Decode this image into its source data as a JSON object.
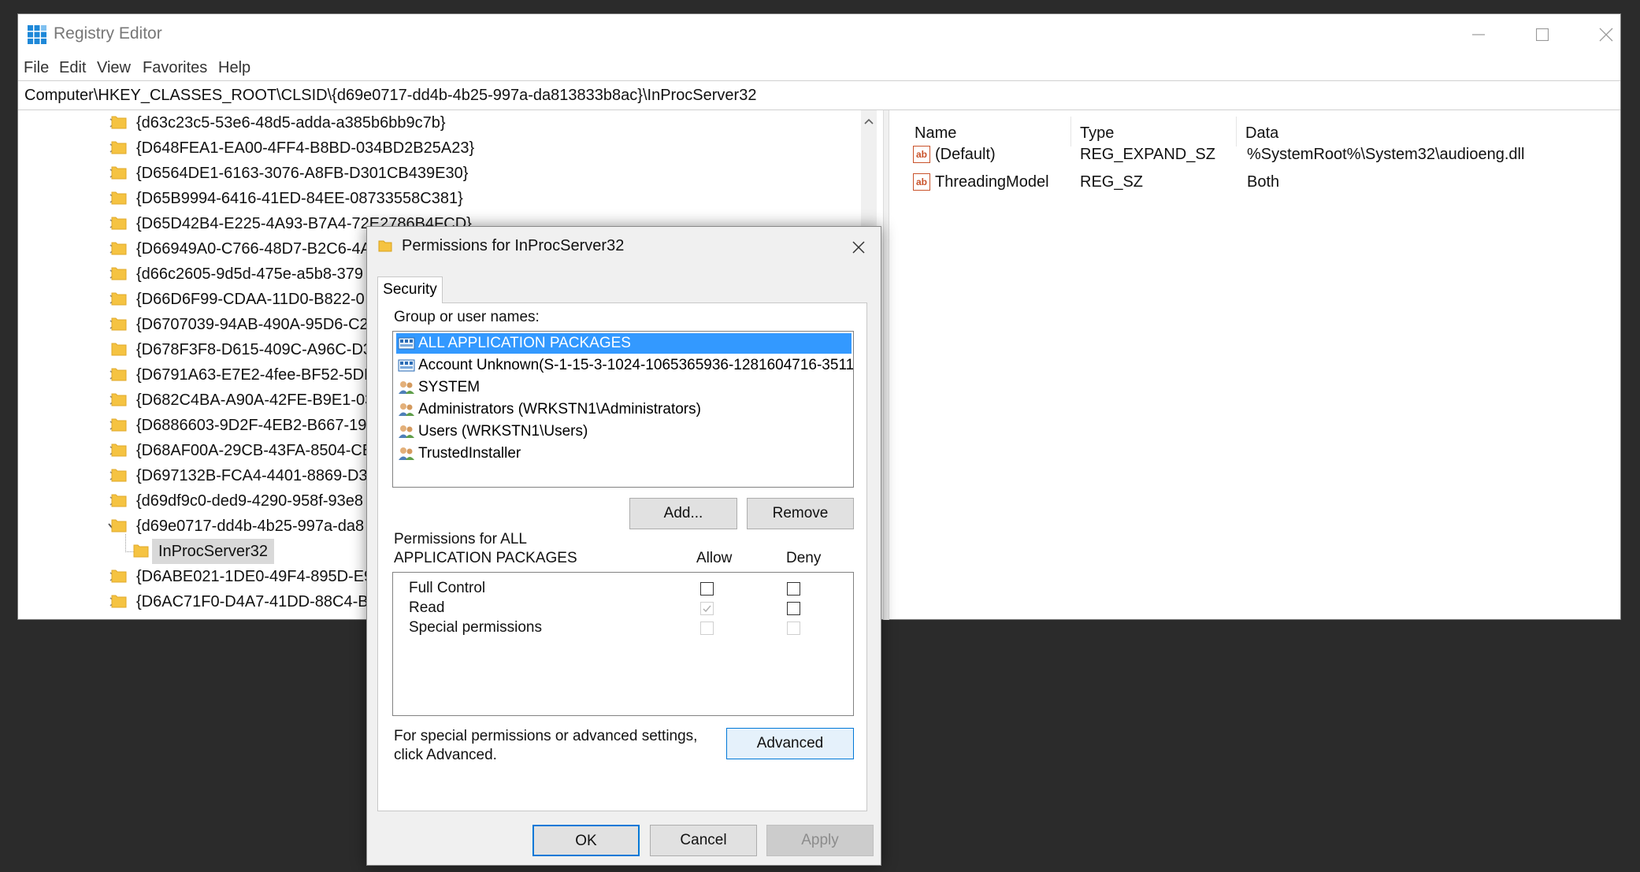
{
  "window": {
    "title": "Registry Editor"
  },
  "menu": [
    "File",
    "Edit",
    "View",
    "Favorites",
    "Help"
  ],
  "address": "Computer\\HKEY_CLASSES_ROOT\\CLSID\\{d69e0717-dd4b-4b25-997a-da813833b8ac}\\InProcServer32",
  "tree": {
    "items": [
      {
        "label": "{d63c23c5-53e6-48d5-adda-a385b6bb9c7b}",
        "expand": "collapsed"
      },
      {
        "label": "{D648FEA1-EA00-4FF4-B8BD-034BD2B25A23}",
        "expand": "collapsed"
      },
      {
        "label": "{D6564DE1-6163-3076-A8FB-D301CB439E30}",
        "expand": "collapsed"
      },
      {
        "label": "{D65B9994-6416-41ED-84EE-08733558C381}",
        "expand": "collapsed"
      },
      {
        "label": "{D65D42B4-E225-4A93-B7A4-72E2786B4FCD}",
        "expand": "collapsed"
      },
      {
        "label": "{D66949A0-C766-48D7-B2C6-4A",
        "expand": "collapsed"
      },
      {
        "label": "{d66c2605-9d5d-475e-a5b8-379",
        "expand": "collapsed"
      },
      {
        "label": "{D66D6F99-CDAA-11D0-B822-0",
        "expand": "collapsed"
      },
      {
        "label": "{D6707039-94AB-490A-95D6-C2",
        "expand": "collapsed"
      },
      {
        "label": "{D678F3F8-D615-409C-A96C-D3",
        "expand": "none"
      },
      {
        "label": "{D6791A63-E7E2-4fee-BF52-5DE",
        "expand": "collapsed"
      },
      {
        "label": "{D682C4BA-A90A-42FE-B9E1-03",
        "expand": "collapsed"
      },
      {
        "label": "{D6886603-9D2F-4EB2-B667-197",
        "expand": "collapsed"
      },
      {
        "label": "{D68AF00A-29CB-43FA-8504-CE",
        "expand": "collapsed"
      },
      {
        "label": "{D697132B-FCA4-4401-8869-D3",
        "expand": "collapsed"
      },
      {
        "label": "{d69df9c0-ded9-4290-958f-93e8",
        "expand": "collapsed"
      },
      {
        "label": "{d69e0717-dd4b-4b25-997a-da8",
        "expand": "expanded"
      },
      {
        "label": "InProcServer32",
        "expand": "child",
        "selected": true
      },
      {
        "label": "{D6ABE021-1DE0-49F4-895D-E9",
        "expand": "collapsed"
      },
      {
        "label": "{D6AC71F0-D4A7-41DD-88C4-B",
        "expand": "collapsed"
      }
    ]
  },
  "values": {
    "headers": {
      "name": "Name",
      "type": "Type",
      "data": "Data"
    },
    "rows": [
      {
        "name": "(Default)",
        "type": "REG_EXPAND_SZ",
        "data": "%SystemRoot%\\System32\\audioeng.dll"
      },
      {
        "name": "ThreadingModel",
        "type": "REG_SZ",
        "data": "Both"
      }
    ]
  },
  "dialog": {
    "title": "Permissions for InProcServer32",
    "tab": "Security",
    "group_label": "Group or user names:",
    "users": [
      {
        "name": "ALL APPLICATION PACKAGES",
        "icon": "package-icon",
        "selected": true
      },
      {
        "name": "Account Unknown(S-1-15-3-1024-1065365936-1281604716-3511...",
        "icon": "package-icon"
      },
      {
        "name": "SYSTEM",
        "icon": "users-icon"
      },
      {
        "name": "Administrators (WRKSTN1\\Administrators)",
        "icon": "users-icon"
      },
      {
        "name": "Users (WRKSTN1\\Users)",
        "icon": "users-icon"
      },
      {
        "name": "TrustedInstaller",
        "icon": "users-icon"
      }
    ],
    "add_label": "Add...",
    "remove_label": "Remove",
    "perm_for_line1": "Permissions for ALL",
    "perm_for_line2": "APPLICATION PACKAGES",
    "allow_label": "Allow",
    "deny_label": "Deny",
    "permissions": [
      {
        "name": "Full Control",
        "allow": false,
        "allow_disabled": false,
        "deny": false,
        "deny_disabled": false
      },
      {
        "name": "Read",
        "allow": true,
        "allow_disabled": true,
        "deny": false,
        "deny_disabled": false
      },
      {
        "name": "Special permissions",
        "allow": false,
        "allow_disabled": true,
        "deny": false,
        "deny_disabled": true
      }
    ],
    "advanced_text_line1": "For special permissions or advanced settings,",
    "advanced_text_line2": "click Advanced.",
    "advanced_label": "Advanced",
    "ok_label": "OK",
    "cancel_label": "Cancel",
    "apply_label": "Apply"
  },
  "colors": {
    "selection": "#3399ff",
    "folder": "#f5c342",
    "accent": "#0078d7"
  }
}
